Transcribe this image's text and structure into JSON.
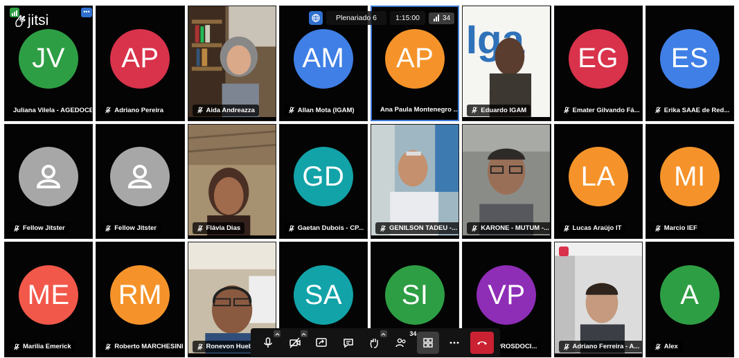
{
  "app": {
    "name": "jitsi"
  },
  "header": {
    "room": "Plenariado 6",
    "timer": "1:15:00",
    "participant_count": "34"
  },
  "participants": [
    {
      "name": "Juliana Vilela - AGEDOCE",
      "initials": "JV",
      "color": "#2e9e44",
      "muted": false
    },
    {
      "name": "Adriano Pereira",
      "initials": "AP",
      "color": "#d9324b",
      "muted": true
    },
    {
      "name": "Aida Andreazza",
      "initials": "",
      "color": "",
      "muted": true,
      "video": "person-bookshelf"
    },
    {
      "name": "Allan Mota (IGAM)",
      "initials": "AM",
      "color": "#3f7fe6",
      "muted": true
    },
    {
      "name": "Ana Paula Montenegro ...",
      "initials": "AP",
      "color": "#f5932a",
      "muted": false,
      "active": true
    },
    {
      "name": "Eduardo IGAM",
      "initials": "",
      "color": "",
      "muted": true,
      "video": "person-igam-banner"
    },
    {
      "name": "Emater Gilvando Fá...",
      "initials": "EG",
      "color": "#d9324b",
      "muted": true
    },
    {
      "name": "Erika SAAE de Red...",
      "initials": "ES",
      "color": "#3f7fe6",
      "muted": true
    },
    {
      "name": "Fellow Jitster",
      "initials": "",
      "color": "",
      "muted": true,
      "default_avatar": true
    },
    {
      "name": "Fellow Jitster",
      "initials": "",
      "color": "",
      "muted": true,
      "default_avatar": true
    },
    {
      "name": "Flávia Dias",
      "initials": "",
      "color": "",
      "muted": true,
      "video": "person-ceiling"
    },
    {
      "name": "Gaetan Dubois - CP...",
      "initials": "GD",
      "color": "#12a3a8",
      "muted": true
    },
    {
      "name": "GENILSON TADEU -...",
      "initials": "",
      "color": "",
      "muted": true,
      "video": "person-office"
    },
    {
      "name": "KARONE - MUTUM -...",
      "initials": "",
      "color": "",
      "muted": true,
      "video": "person-glasses"
    },
    {
      "name": "Lucas Araújo IT",
      "initials": "LA",
      "color": "#f5932a",
      "muted": true
    },
    {
      "name": "Marcio IEF",
      "initials": "MI",
      "color": "#f5932a",
      "muted": true
    },
    {
      "name": "Marilia Emerick",
      "initials": "ME",
      "color": "#f2584a",
      "muted": true
    },
    {
      "name": "Roberto MARCHESINI",
      "initials": "RM",
      "color": "#f5932a",
      "muted": true
    },
    {
      "name": "Ronevon Huebra",
      "initials": "",
      "color": "",
      "muted": true,
      "video": "person-headset"
    },
    {
      "name": "",
      "initials": "SA",
      "color": "#12a3a8",
      "muted": true
    },
    {
      "name": "",
      "initials": "SI",
      "color": "#2e9e44",
      "muted": true
    },
    {
      "name": "TOR PROSDOCI...",
      "initials": "VP",
      "color": "#8e2db6",
      "muted": true
    },
    {
      "name": "Adriano Ferreira - A...",
      "initials": "",
      "color": "",
      "muted": true,
      "video": "person-room",
      "weak_signal": true
    },
    {
      "name": "Alex",
      "initials": "A",
      "color": "#2e9e44",
      "muted": true
    }
  ],
  "toolbar": {
    "participants_count": "34",
    "buttons": [
      "microphone-icon",
      "camera-off-icon",
      "share-screen-icon",
      "chat-icon",
      "raise-hand-icon",
      "participants-icon",
      "tile-view-icon",
      "more-icon",
      "hangup-icon"
    ]
  }
}
